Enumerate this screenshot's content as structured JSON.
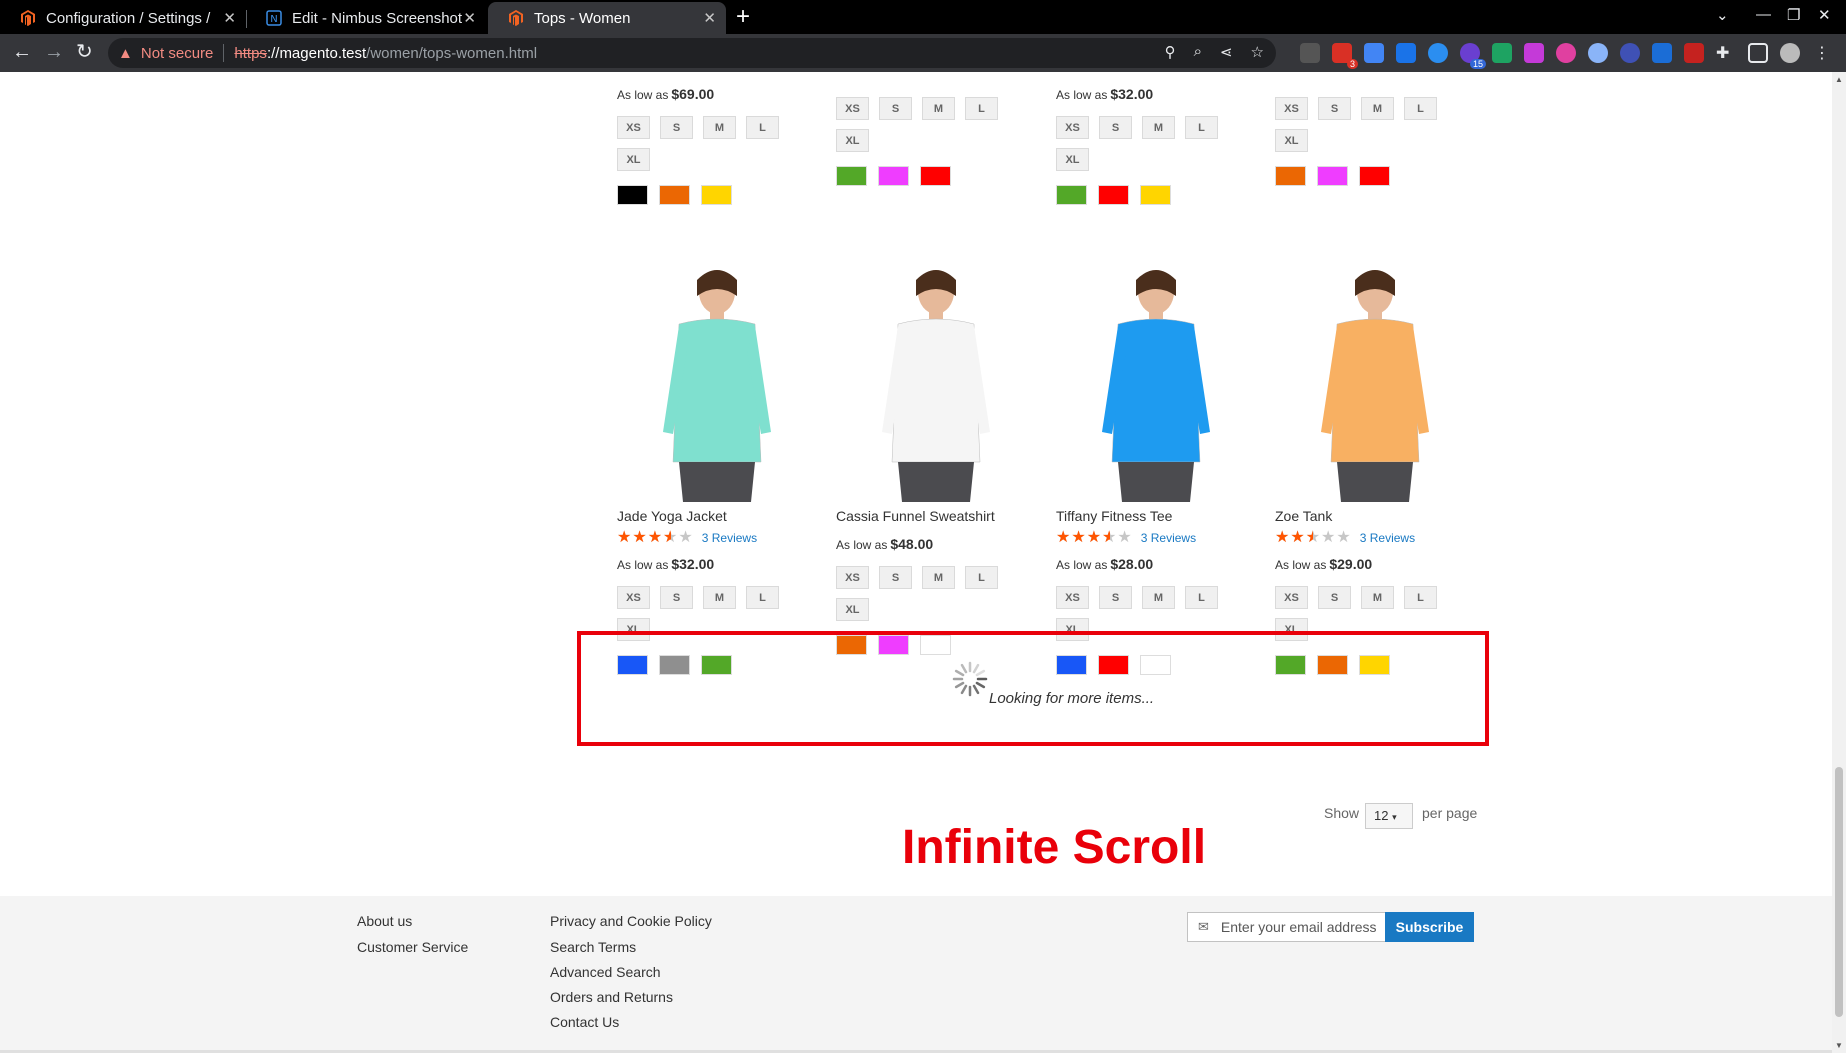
{
  "browser": {
    "tabs": [
      {
        "title": "Configuration / Settings /",
        "icon": "magento-icon"
      },
      {
        "title": "Edit - Nimbus Screenshot",
        "icon": "nimbus-icon"
      },
      {
        "title": "Tops - Women",
        "icon": "magento-icon"
      }
    ],
    "address": {
      "security_label": "Not secure",
      "scheme": "https",
      "host": "://magento.test",
      "path": "/women/tops-women.html"
    },
    "extension_badges": {
      "mail": "3",
      "puzzle": "15"
    }
  },
  "top_row": [
    {
      "price_label": "As low as",
      "price": "$69.00",
      "sizes": [
        "XS",
        "S",
        "M",
        "L",
        "XL"
      ],
      "colors": [
        "#000000",
        "#eb6703",
        "#ffd500"
      ]
    },
    {
      "price_label": "",
      "price": "",
      "sizes": [
        "XS",
        "S",
        "M",
        "L",
        "XL"
      ],
      "colors": [
        "#53a828",
        "#ef3dff",
        "#ff0000"
      ]
    },
    {
      "price_label": "As low as",
      "price": "$32.00",
      "sizes": [
        "XS",
        "S",
        "M",
        "L",
        "XL"
      ],
      "colors": [
        "#53a828",
        "#ff0000",
        "#ffd500"
      ]
    },
    {
      "price_label": "",
      "price": "",
      "sizes": [
        "XS",
        "S",
        "M",
        "L",
        "XL"
      ],
      "colors": [
        "#eb6703",
        "#ef3dff",
        "#ff0000"
      ]
    }
  ],
  "products": [
    {
      "name": "Jade Yoga Jacket",
      "rating": 0.7,
      "reviews": "3  Reviews",
      "price_label": "As low as",
      "price": "$32.00",
      "sizes": [
        "XS",
        "S",
        "M",
        "L",
        "XL"
      ],
      "colors": [
        "#1857f7",
        "#8f8f8f",
        "#53a828"
      ],
      "shirt": "#7fe0cf"
    },
    {
      "name": "Cassia Funnel Sweatshirt",
      "rating": null,
      "reviews": "",
      "price_label": "As low as",
      "price": "$48.00",
      "sizes": [
        "XS",
        "S",
        "M",
        "L",
        "XL"
      ],
      "colors": [
        "#eb6703",
        "#ef3dff",
        "#ffffff"
      ],
      "shirt": "#f5f5f5"
    },
    {
      "name": "Tiffany Fitness Tee",
      "rating": 0.7,
      "reviews": "3  Reviews",
      "price_label": "As low as",
      "price": "$28.00",
      "sizes": [
        "XS",
        "S",
        "M",
        "L",
        "XL"
      ],
      "colors": [
        "#1857f7",
        "#ff0000",
        "#ffffff"
      ],
      "shirt": "#1e9bf0"
    },
    {
      "name": "Zoe Tank",
      "rating": 0.5,
      "reviews": "3  Reviews",
      "price_label": "As low as",
      "price": "$29.00",
      "sizes": [
        "XS",
        "S",
        "M",
        "L",
        "XL"
      ],
      "colors": [
        "#53a828",
        "#eb6703",
        "#ffd500"
      ],
      "shirt": "#f8b062"
    }
  ],
  "loader": {
    "text": "Looking for more items..."
  },
  "toolbar": {
    "show_label": "Show",
    "limit_value": "12",
    "per_page_label": "per page"
  },
  "annotation": {
    "text": "Infinite Scroll"
  },
  "footer": {
    "col1": [
      "About us",
      "Customer Service"
    ],
    "col2": [
      "Privacy and Cookie Policy",
      "Search Terms",
      "Advanced Search",
      "Orders and Returns",
      "Contact Us"
    ],
    "newsletter_placeholder": "Enter your email address",
    "subscribe_label": "Subscribe"
  }
}
